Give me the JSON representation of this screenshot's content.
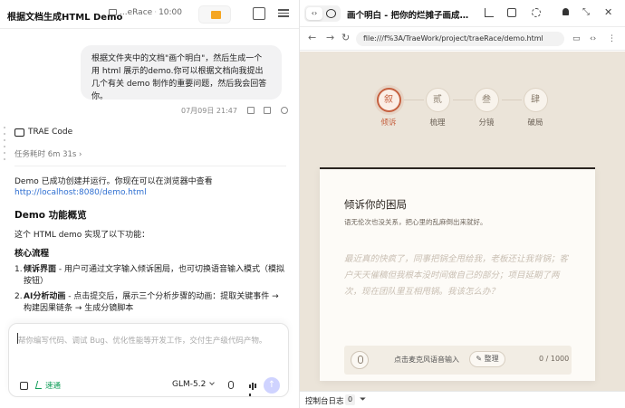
{
  "left": {
    "title": "根据文档生成HTML Demo",
    "folder_name": "...eRace",
    "time": "10:00",
    "bubble_text": "根据文件夹中的文档\"画个明白\"，然后生成一个 用 html 展示的demo.你可以根据文档向我提出几个有关 demo 制作的重要问题，然后我会回答你。",
    "bubble_meta": "07月09日 21:47",
    "agent_name": "TRAE Code",
    "task_duration": "任务耗时 6m 31s",
    "response_line1": "Demo 已成功创建并运行。你现在可以在浏览器中查看",
    "response_link": "http://localhost:8080/demo.html",
    "heading": "Demo 功能概览",
    "intro": "这个 HTML demo 实现了以下功能：",
    "subheading": "核心流程",
    "list": [
      {
        "num": "1.",
        "bold": "倾诉界面",
        "text": " - 用户可通过文字输入倾诉困局，也可切换语音输入模式（模拟按钮）"
      },
      {
        "num": "2.",
        "bold": "AI分析动画",
        "text": " - 点击提交后，展示三个分析步骤的动画：提取关键事件 → 构建因果链条 → 生成分镜脚本"
      }
    ],
    "input_placeholder": "帮你编写代码、调试 Bug、优化性能等开发工作，交付生产级代码产物。",
    "quick_label": "速通",
    "model": "GLM-5.2"
  },
  "right": {
    "title": "画个明白 - 把你的烂摊子画成漫...",
    "url": "file:///f%3A/TraeWork/project/traeRace/demo.html",
    "steps": [
      {
        "char": "叙",
        "label": "倾诉"
      },
      {
        "char": "贰",
        "label": "梳理"
      },
      {
        "char": "叁",
        "label": "分镜"
      },
      {
        "char": "肆",
        "label": "破局"
      }
    ],
    "card_title": "倾诉你的困局",
    "card_subtitle": "语无伦次也没关系，把心里的乱麻倒出来就好。",
    "card_placeholder": "最近真的快疯了，同事把锅全甩给我，老板还让我背锅；客户天天催稿但我根本没时间做自己的部分；项目延期了两次，现在团队里互相甩锅。我该怎么办？",
    "mic_hint": "点击麦克风语音输入",
    "organize_label": "整理",
    "counter": "0 / 1000",
    "console_label": "控制台日志",
    "console_count": "0"
  },
  "colors": {
    "accent": "#c5603f",
    "page_bg": "#ebe4d9",
    "link": "#2f6fd1",
    "quick": "#0f9d58"
  }
}
